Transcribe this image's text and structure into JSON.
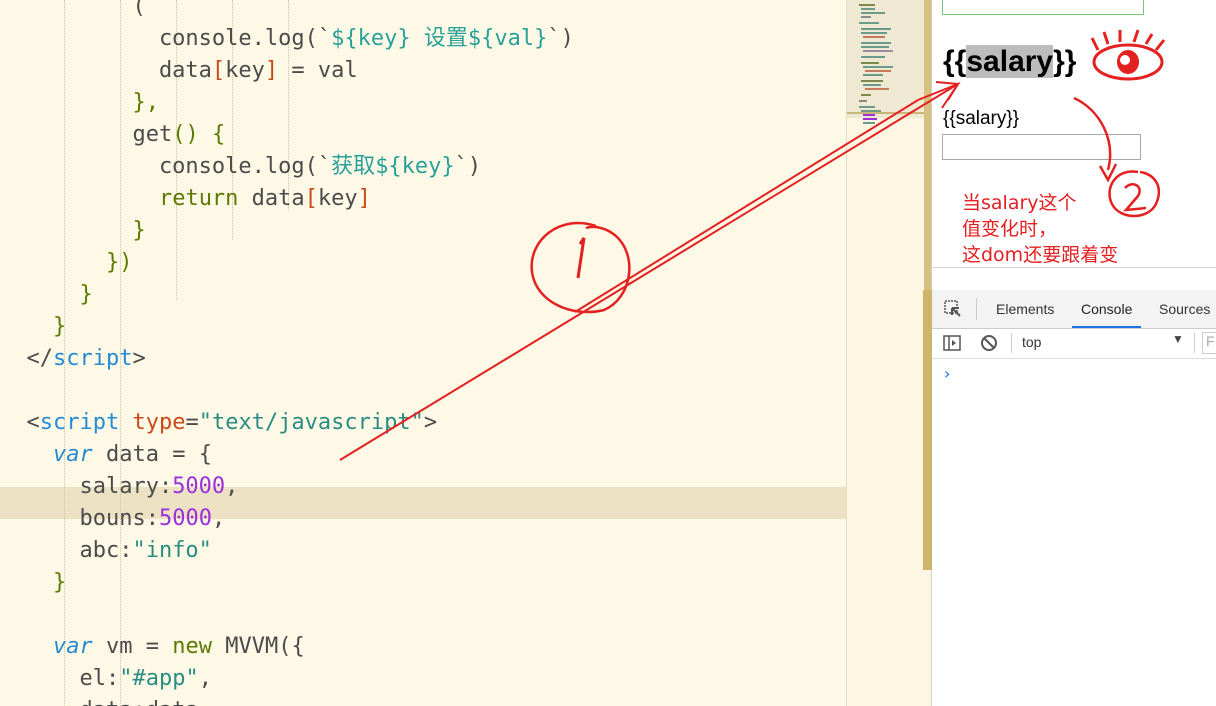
{
  "editor": {
    "lines": [
      [
        {
          "t": "          ",
          "c": "plain"
        },
        {
          "t": "(",
          "c": "plain"
        }
      ],
      [
        {
          "t": "            console",
          "c": "plain"
        },
        {
          "t": ".",
          "c": "plain"
        },
        {
          "t": "log",
          "c": "plain"
        },
        {
          "t": "(`",
          "c": "plain"
        },
        {
          "t": "${key} ",
          "c": "teal"
        },
        {
          "t": "设置",
          "c": "teal"
        },
        {
          "t": "${val}",
          "c": "teal"
        },
        {
          "t": "`)",
          "c": "plain"
        }
      ],
      [
        {
          "t": "            data",
          "c": "plain"
        },
        {
          "t": "[",
          "c": "red"
        },
        {
          "t": "key",
          "c": "plain"
        },
        {
          "t": "]",
          "c": "red"
        },
        {
          "t": " = val",
          "c": "plain"
        }
      ],
      [
        {
          "t": "          },",
          "c": "green"
        }
      ],
      [
        {
          "t": "          ",
          "c": "plain"
        },
        {
          "t": "get",
          "c": "plain"
        },
        {
          "t": "() {",
          "c": "green"
        }
      ],
      [
        {
          "t": "            console",
          "c": "plain"
        },
        {
          "t": ".",
          "c": "plain"
        },
        {
          "t": "log",
          "c": "plain"
        },
        {
          "t": "(`",
          "c": "plain"
        },
        {
          "t": "获取",
          "c": "teal"
        },
        {
          "t": "${key}",
          "c": "teal"
        },
        {
          "t": "`)",
          "c": "plain"
        }
      ],
      [
        {
          "t": "            ",
          "c": "plain"
        },
        {
          "t": "return",
          "c": "green"
        },
        {
          "t": " data",
          "c": "plain"
        },
        {
          "t": "[",
          "c": "red"
        },
        {
          "t": "key",
          "c": "plain"
        },
        {
          "t": "]",
          "c": "red"
        }
      ],
      [
        {
          "t": "          }",
          "c": "green"
        }
      ],
      [
        {
          "t": "        })",
          "c": "green"
        }
      ],
      [
        {
          "t": "      }",
          "c": "green"
        }
      ],
      [
        {
          "t": "    }",
          "c": "green"
        }
      ],
      [
        {
          "t": "  </",
          "c": "plain"
        },
        {
          "t": "script",
          "c": "blue"
        },
        {
          "t": ">",
          "c": "plain"
        }
      ],
      [
        {
          "t": "",
          "c": "plain"
        }
      ],
      [
        {
          "t": "  <",
          "c": "plain"
        },
        {
          "t": "script",
          "c": "blue"
        },
        {
          "t": " ",
          "c": "plain"
        },
        {
          "t": "type",
          "c": "red"
        },
        {
          "t": "=",
          "c": "plain"
        },
        {
          "t": "\"text/javascript\"",
          "c": "str"
        },
        {
          "t": ">",
          "c": "plain"
        }
      ],
      [
        {
          "t": "    ",
          "c": "plain"
        },
        {
          "t": "var",
          "c": "kw"
        },
        {
          "t": " data = {",
          "c": "plain"
        }
      ],
      [
        {
          "t": "      salary:",
          "c": "plain"
        },
        {
          "t": "5000",
          "c": "num"
        },
        {
          "t": ",",
          "c": "plain"
        }
      ],
      [
        {
          "t": "      bouns:",
          "c": "plain"
        },
        {
          "t": "5000",
          "c": "num"
        },
        {
          "t": ",",
          "c": "plain"
        }
      ],
      [
        {
          "t": "      abc:",
          "c": "plain"
        },
        {
          "t": "\"info\"",
          "c": "str"
        }
      ],
      [
        {
          "t": "    }",
          "c": "green"
        }
      ],
      [
        {
          "t": "",
          "c": "plain"
        }
      ],
      [
        {
          "t": "    ",
          "c": "plain"
        },
        {
          "t": "var",
          "c": "kw"
        },
        {
          "t": " vm = ",
          "c": "plain"
        },
        {
          "t": "new",
          "c": "green"
        },
        {
          "t": " MVVM({",
          "c": "plain"
        }
      ],
      [
        {
          "t": "      el:",
          "c": "plain"
        },
        {
          "t": "\"#app\"",
          "c": "str"
        },
        {
          "t": ",",
          "c": "plain"
        }
      ],
      [
        {
          "t": "      data:data",
          "c": "plain"
        }
      ]
    ]
  },
  "preview": {
    "big_text_left": "{{",
    "big_text_mid": "salary",
    "big_text_right": "}}",
    "small_label": "{{salary}}",
    "input_value": "",
    "annotation": "当salary这个\n值变化时，\n这dom还要跟着变"
  },
  "devtools": {
    "tabs": [
      "Elements",
      "Console",
      "Sources"
    ],
    "active_tab": "Console",
    "context": "top",
    "filter_placeholder": "F",
    "prompt": "›"
  },
  "annotations": {
    "circle_1": "1",
    "circle_2": "2"
  },
  "colors": {
    "editor_bg": "#fef8e6",
    "annotation_red": "#e42020",
    "active_tab_underline": "#1a73e8"
  }
}
